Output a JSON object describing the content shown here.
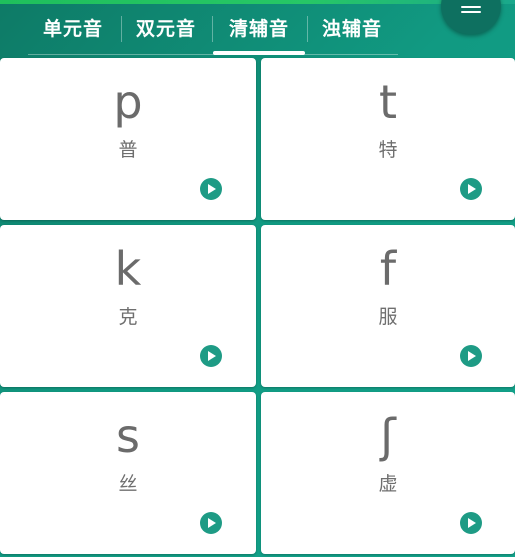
{
  "tabs": [
    {
      "label": "单元音"
    },
    {
      "label": "双元音"
    },
    {
      "label": "清辅音"
    },
    {
      "label": "浊辅音"
    }
  ],
  "active_tab": "清辅音",
  "cards": [
    {
      "symbol": "p",
      "hanzi": "普"
    },
    {
      "symbol": "t",
      "hanzi": "特"
    },
    {
      "symbol": "k",
      "hanzi": "克"
    },
    {
      "symbol": "f",
      "hanzi": "服"
    },
    {
      "symbol": "s",
      "hanzi": "丝"
    },
    {
      "symbol": "ʃ",
      "hanzi": "虚"
    }
  ],
  "icons": {
    "menu": "menu-icon",
    "play": "play-icon"
  },
  "colors": {
    "primary": "#119a82",
    "accent": "#1e9b85",
    "card": "#ffffff",
    "text": "#6b6b6b"
  }
}
